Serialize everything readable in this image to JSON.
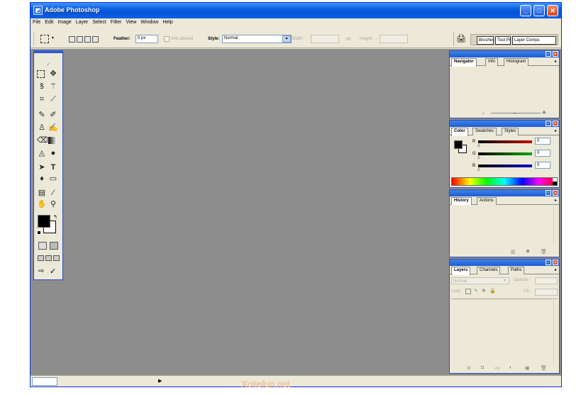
{
  "window": {
    "title": "Adobe Photoshop",
    "min_glyph": "_",
    "max_glyph": "□",
    "close_glyph": "✕"
  },
  "menu": [
    "File",
    "Edit",
    "Image",
    "Layer",
    "Select",
    "Filter",
    "View",
    "Window",
    "Help"
  ],
  "options": {
    "feather_label": "Feather:",
    "feather_value": "0 px",
    "antialiased_label": "Anti-aliased",
    "style_label": "Style:",
    "style_value": "Normal",
    "width_label": "Width:",
    "height_label": "Height:"
  },
  "palette_well": {
    "tabs": [
      "Brushes",
      "Tool Presets",
      "Layer Comps"
    ]
  },
  "navigator_panel": {
    "tabs": [
      "Navigator",
      "Info",
      "Histogram"
    ]
  },
  "color_panel": {
    "tabs": [
      "Color",
      "Swatches",
      "Styles"
    ],
    "channels": [
      {
        "label": "R",
        "value": "0",
        "color": "#cc0000"
      },
      {
        "label": "G",
        "value": "0",
        "color": "#00aa00"
      },
      {
        "label": "B",
        "value": "0",
        "color": "#0000cc"
      }
    ]
  },
  "history_panel": {
    "tabs": [
      "History",
      "Actions"
    ]
  },
  "layers_panel": {
    "tabs": [
      "Layers",
      "Channels",
      "Paths"
    ],
    "blend_mode": "Normal",
    "opacity_label": "Opacity:",
    "lock_label": "Lock:",
    "fill_label": "Fill:"
  },
  "watermark": "Xcitefun.net",
  "colors": {
    "title_blue": "#0553d6",
    "workspace_gray": "#8d8d8d",
    "chrome": "#ece9d8"
  }
}
